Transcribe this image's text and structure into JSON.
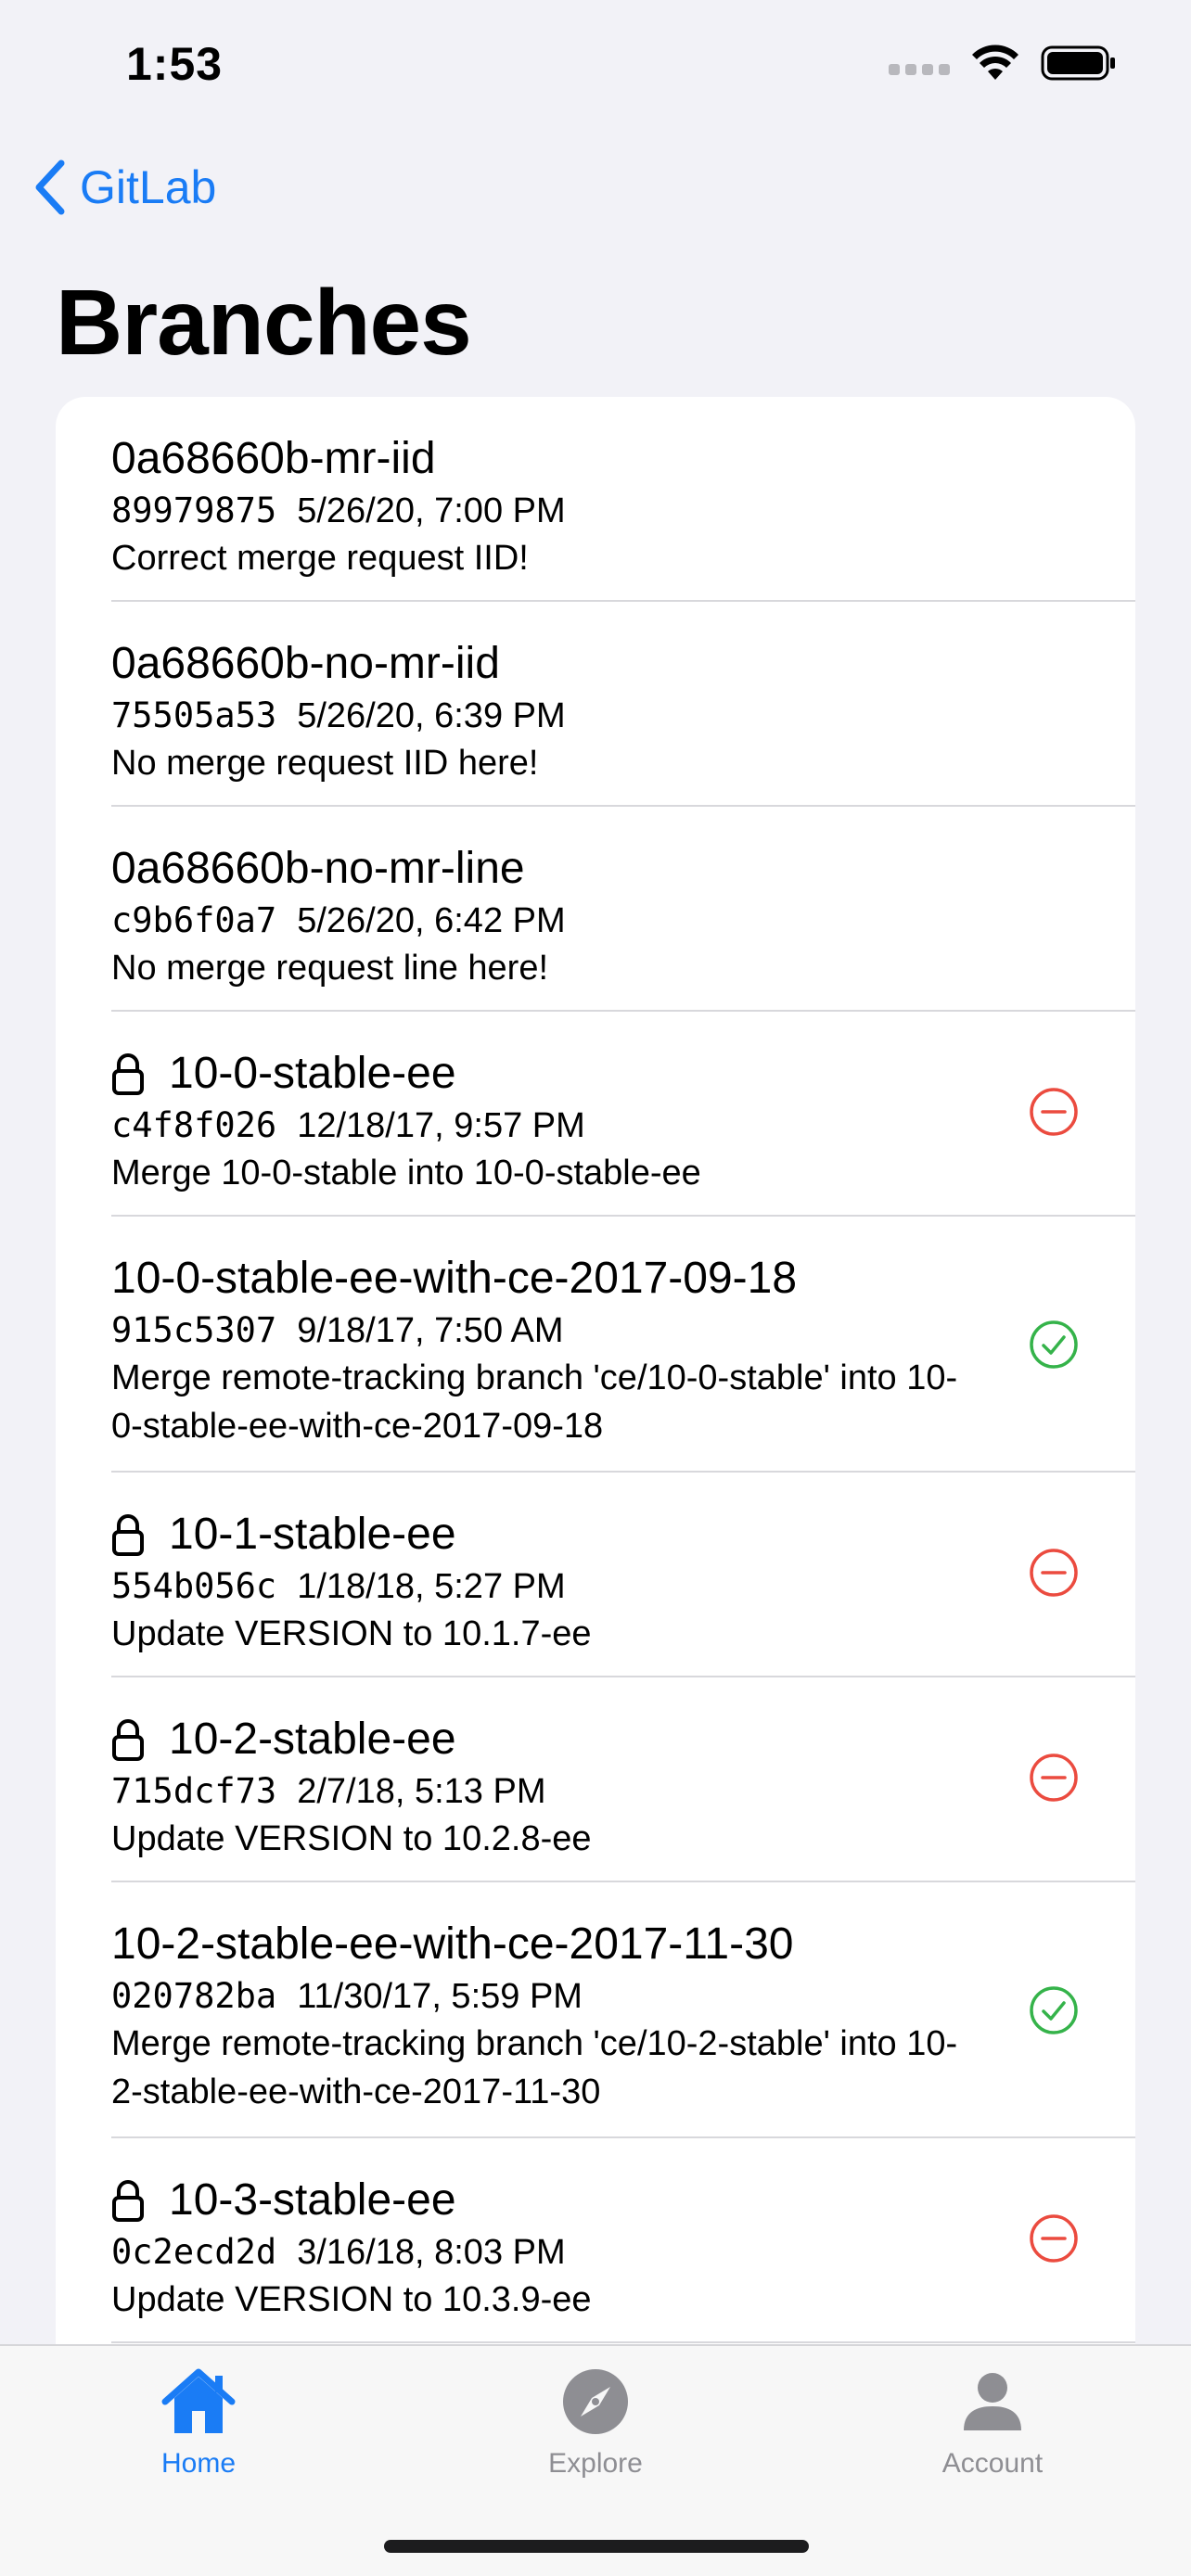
{
  "status_bar": {
    "time": "1:53"
  },
  "nav": {
    "back_label": "GitLab"
  },
  "page": {
    "title": "Branches"
  },
  "branches": [
    {
      "name": "0a68660b-mr-iid",
      "sha": "89979875",
      "date": "5/26/20, 7:00 PM",
      "message": "Correct merge request IID!",
      "locked": false,
      "status": "none"
    },
    {
      "name": "0a68660b-no-mr-iid",
      "sha": "75505a53",
      "date": "5/26/20, 6:39 PM",
      "message": "No merge request IID here!",
      "locked": false,
      "status": "none"
    },
    {
      "name": "0a68660b-no-mr-line",
      "sha": "c9b6f0a7",
      "date": "5/26/20, 6:42 PM",
      "message": "No merge request line here!",
      "locked": false,
      "status": "none"
    },
    {
      "name": "10-0-stable-ee",
      "sha": "c4f8f026",
      "date": "12/18/17, 9:57 PM",
      "message": "Merge 10-0-stable into 10-0-stable-ee",
      "locked": true,
      "status": "failed"
    },
    {
      "name": "10-0-stable-ee-with-ce-2017-09-18",
      "sha": "915c5307",
      "date": "9/18/17, 7:50 AM",
      "message": "Merge remote-tracking branch 'ce/10-0-stable' into 10-0-stable-ee-with-ce-2017-09-18",
      "locked": false,
      "status": "passed"
    },
    {
      "name": "10-1-stable-ee",
      "sha": "554b056c",
      "date": "1/18/18, 5:27 PM",
      "message": "Update VERSION to 10.1.7-ee",
      "locked": true,
      "status": "failed"
    },
    {
      "name": "10-2-stable-ee",
      "sha": "715dcf73",
      "date": "2/7/18, 5:13 PM",
      "message": "Update VERSION to 10.2.8-ee",
      "locked": true,
      "status": "failed"
    },
    {
      "name": "10-2-stable-ee-with-ce-2017-11-30",
      "sha": "020782ba",
      "date": "11/30/17, 5:59 PM",
      "message": "Merge remote-tracking branch 'ce/10-2-stable' into 10-2-stable-ee-with-ce-2017-11-30",
      "locked": false,
      "status": "passed"
    },
    {
      "name": "10-3-stable-ee",
      "sha": "0c2ecd2d",
      "date": "3/16/18, 8:03 PM",
      "message": "Update VERSION to 10.3.9-ee",
      "locked": true,
      "status": "failed"
    }
  ],
  "tabs": [
    {
      "label": "Home",
      "icon": "house-icon",
      "active": true
    },
    {
      "label": "Explore",
      "icon": "compass-icon",
      "active": false
    },
    {
      "label": "Account",
      "icon": "person-icon",
      "active": false
    }
  ],
  "colors": {
    "accent": "#1a7cf5",
    "failed": "#eb4b3f",
    "passed": "#35b34a",
    "inactive_tab": "#8e8e93"
  }
}
